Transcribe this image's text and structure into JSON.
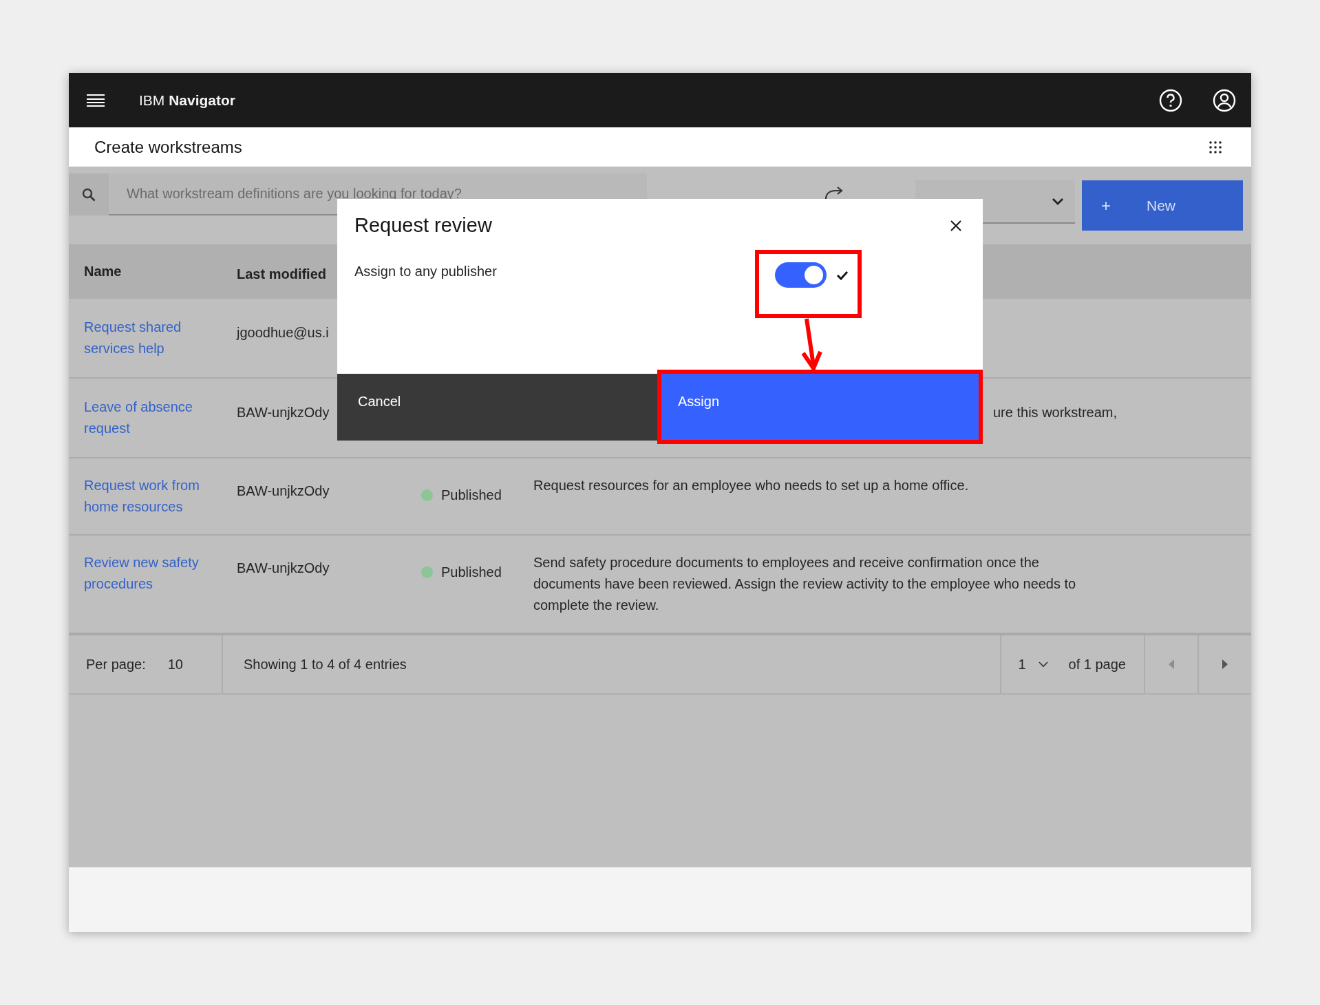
{
  "header": {
    "brand_prefix": "IBM",
    "brand_name": "Navigator"
  },
  "page_title": "Create workstreams",
  "search": {
    "placeholder": "What workstream definitions are you looking for today?"
  },
  "new_button": {
    "icon": "+",
    "label": "New"
  },
  "table": {
    "columns": [
      "Name",
      "Last modified"
    ],
    "rows": [
      {
        "kind": "covered",
        "name": "Request shared services help",
        "modified": "jgoodhue@us.i"
      },
      {
        "kind": "covered",
        "name": "Leave of absence request",
        "modified": "BAW-unjkzOdy",
        "description": "ure this workstream,"
      },
      {
        "kind": "full",
        "name": "Request work from home resources",
        "modified": "BAW-unjkzOdy",
        "status": {
          "label": "Published",
          "color": "#8cc596"
        },
        "description": "Request resources for an employee who needs to set up a home office."
      },
      {
        "kind": "full",
        "name": "Review new safety procedures",
        "modified": "BAW-unjkzOdy",
        "status": {
          "label": "Published",
          "color": "#8cc596"
        },
        "description": "Send safety procedure documents to employees and receive confirmation once the documents have been reviewed. Assign the review activity to the employee who needs to complete the review."
      }
    ]
  },
  "pagination": {
    "per_page_label": "Per page:",
    "per_page": "10",
    "summary": "Showing 1 to 4 of 4 entries",
    "page": "1",
    "page_total": "of 1 page"
  },
  "dialog": {
    "title": "Request review",
    "option": {
      "label": "Assign to any publisher",
      "on": true
    },
    "buttons": [
      {
        "label": "Cancel",
        "kind": "secondary"
      },
      {
        "label": "Assign",
        "kind": "primary"
      }
    ]
  }
}
